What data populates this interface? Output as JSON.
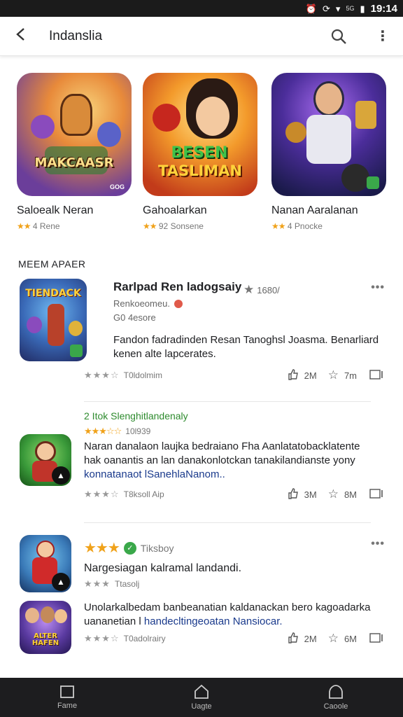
{
  "status_bar": {
    "time": "19:14",
    "network": "5G"
  },
  "app_bar": {
    "title": "Indanslia"
  },
  "featured": [
    {
      "name": "Saloealk Neran",
      "rating": "4",
      "reviews": "Rene",
      "art_text": "MAKCAASR",
      "badge": "GOG"
    },
    {
      "name": "Gahoalarkan",
      "rating": "92",
      "reviews": "Sonsene",
      "art_text_1": "BESEN",
      "art_text_2": "TASLIMAN"
    },
    {
      "name": "Nanan Aaralanan",
      "rating": "4",
      "reviews": "Pnocke"
    }
  ],
  "section": {
    "header": "MEEM APAER"
  },
  "items": [
    {
      "title": "Rarlpad Ren ladogsaiy",
      "rating_num": "1680/",
      "developer": "Renkoeomeu.",
      "category": "G0 4esore",
      "description": "Fandon fadradinden Resan Tanoghsl Joasma. Benarliard kenen alte lapcerates.",
      "meta": "T0ldolmim",
      "likes": "2M",
      "favs": "7m",
      "thumb_text": "TIENDACK"
    },
    {
      "tag": "2 Itok Slenghitlandenaly",
      "meta_top": "10l939",
      "description": "Naran danalaon laujka bedraiano Fha Aanlatatobacklatente hak oanantis an lan danakonlotckan tanakilandianste yony",
      "link": "konnatanaot lSanehlaNanom..",
      "meta": "T8ksoll Aip",
      "likes": "3M",
      "favs": "8M"
    },
    {
      "meta_top": "Tiksboy",
      "title": "Nargesiagan kalramal landandi.",
      "meta2": "Ttasolj",
      "description": "Unolarkalbedam banbeanatian kaldanackan bero kagoadarka uananetian l",
      "link": "handecltingeoatan Nansiocar.",
      "meta": "T0adolrairy",
      "likes": "2M",
      "favs": "6M",
      "thumb_text": "ALTER HAFEN"
    }
  ],
  "bottom_nav": [
    {
      "label": "Fame"
    },
    {
      "label": "Uagte"
    },
    {
      "label": "Caoole"
    }
  ]
}
